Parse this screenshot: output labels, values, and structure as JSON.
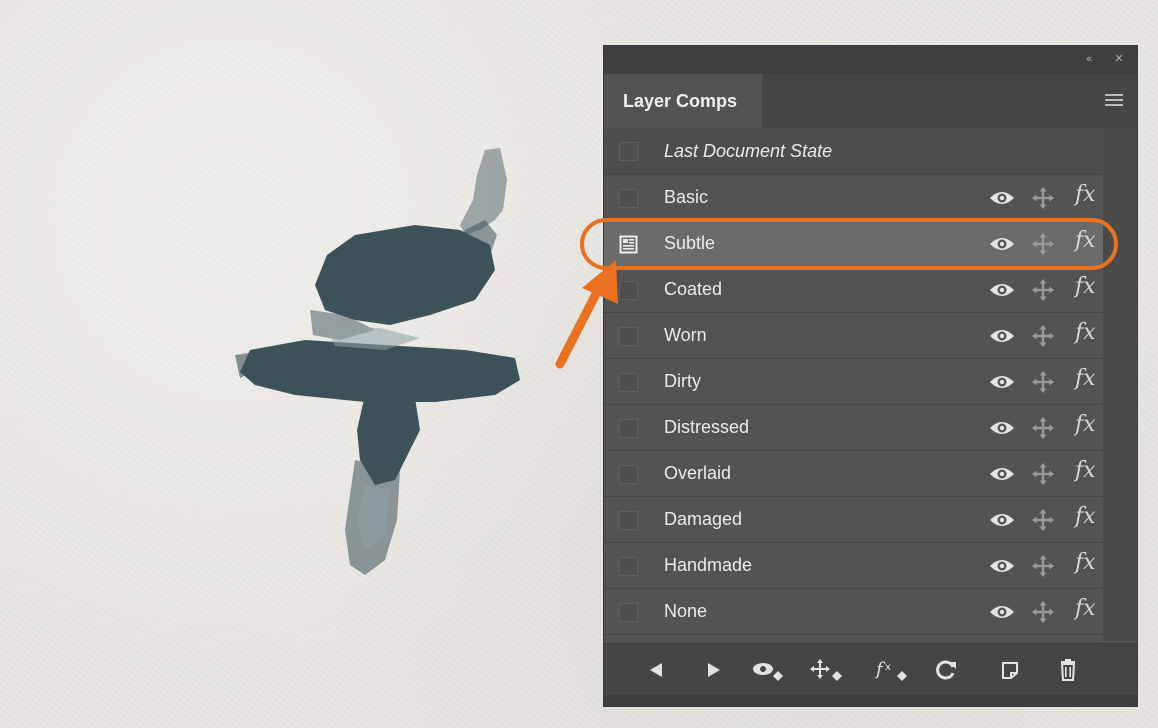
{
  "panel": {
    "tab_label": "Layer Comps",
    "collapse_glyph": "«",
    "close_glyph": "✕",
    "rows": [
      {
        "label": "Last Document State",
        "kind": "last-doc"
      },
      {
        "label": "Basic",
        "kind": "comp"
      },
      {
        "label": "Subtle",
        "kind": "comp",
        "selected": true
      },
      {
        "label": "Coated",
        "kind": "comp"
      },
      {
        "label": "Worn",
        "kind": "comp"
      },
      {
        "label": "Dirty",
        "kind": "comp"
      },
      {
        "label": "Distressed",
        "kind": "comp"
      },
      {
        "label": "Overlaid",
        "kind": "comp"
      },
      {
        "label": "Damaged",
        "kind": "comp"
      },
      {
        "label": "Handmade",
        "kind": "comp"
      },
      {
        "label": "None",
        "kind": "comp"
      }
    ],
    "row_icons": {
      "visibility": "eye-icon",
      "position": "move-icon",
      "style": "fx-icon",
      "fx_glyph": "fx"
    },
    "footer_buttons": [
      "previous-comp-icon",
      "next-comp-icon",
      "apply-visibility-icon",
      "apply-position-icon",
      "apply-style-icon",
      "update-comp-icon",
      "new-comp-icon",
      "delete-comp-icon"
    ]
  },
  "colors": {
    "accent_callout": "#e9711f",
    "panel_bg": "#535353",
    "selected_row": "#6b6b6b",
    "paint": "#3d5258"
  }
}
